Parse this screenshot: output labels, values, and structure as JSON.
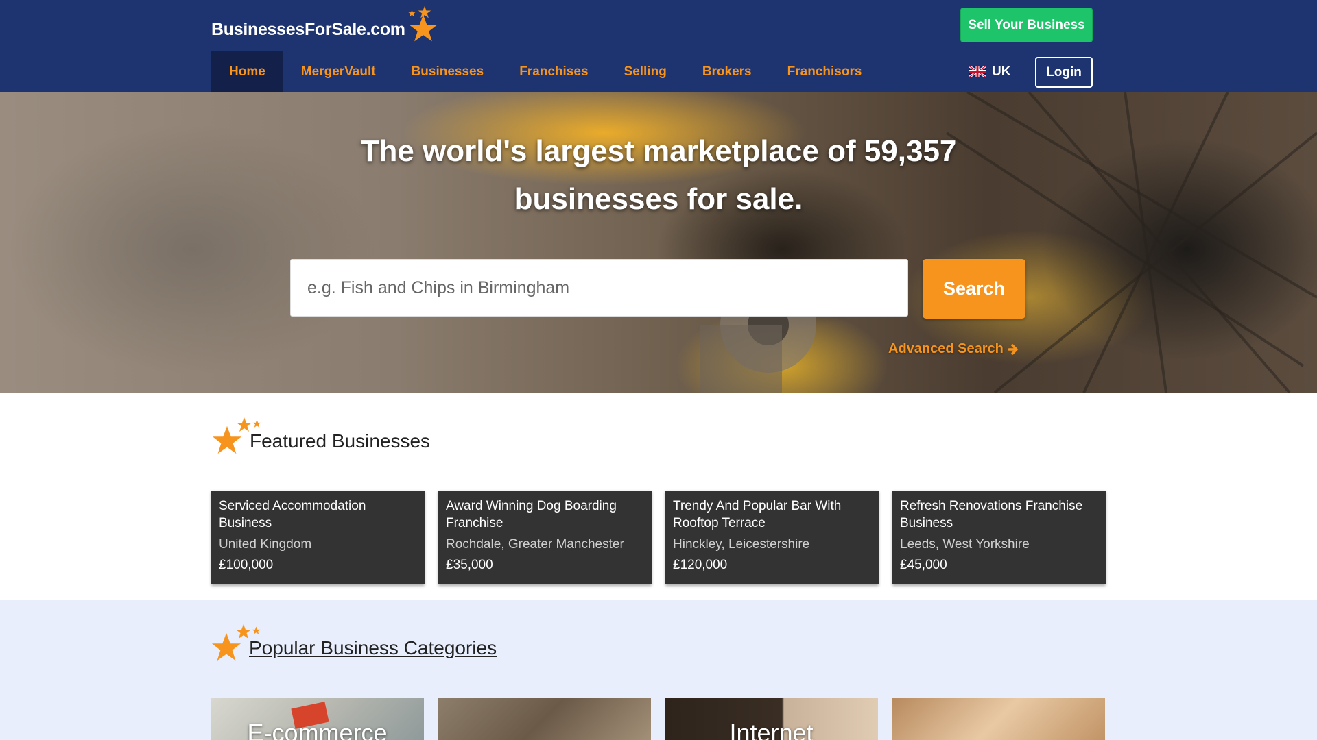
{
  "header": {
    "logo_text": "BusinessesForSale.com",
    "sell_button": "Sell Your Business",
    "brand_color": "#1e3470",
    "accent_color": "#f7941d",
    "sell_color": "#1ec46a"
  },
  "nav": {
    "items": [
      {
        "label": "Home",
        "active": true
      },
      {
        "label": "MergerVault",
        "active": false
      },
      {
        "label": "Businesses",
        "active": false
      },
      {
        "label": "Franchises",
        "active": false
      },
      {
        "label": "Selling",
        "active": false
      },
      {
        "label": "Brokers",
        "active": false
      },
      {
        "label": "Franchisors",
        "active": false
      }
    ],
    "locale": "UK",
    "locale_icon": "uk-flag-icon",
    "login": "Login"
  },
  "hero": {
    "title": "The world's largest marketplace of 59,357 businesses for sale.",
    "search_placeholder": "e.g. Fish and Chips in Birmingham",
    "search_button": "Search",
    "advanced_search": "Advanced Search"
  },
  "featured": {
    "title": "Featured Businesses",
    "cards": [
      {
        "title": "Serviced Accommodation Business",
        "location": "United Kingdom",
        "price": "£100,000"
      },
      {
        "title": "Award Winning Dog Boarding Franchise",
        "location": "Rochdale, Greater Manchester",
        "price": "£35,000"
      },
      {
        "title": "Trendy And Popular Bar With Rooftop Terrace",
        "location": "Hinckley, Leicestershire",
        "price": "£120,000"
      },
      {
        "title": "Refresh Renovations Franchise Business",
        "location": "Leeds, West Yorkshire",
        "price": "£45,000"
      }
    ]
  },
  "popular": {
    "title": "Popular Business Categories",
    "categories": [
      {
        "label": "E-commerce"
      },
      {
        "label": ""
      },
      {
        "label": "Internet"
      },
      {
        "label": ""
      }
    ]
  }
}
